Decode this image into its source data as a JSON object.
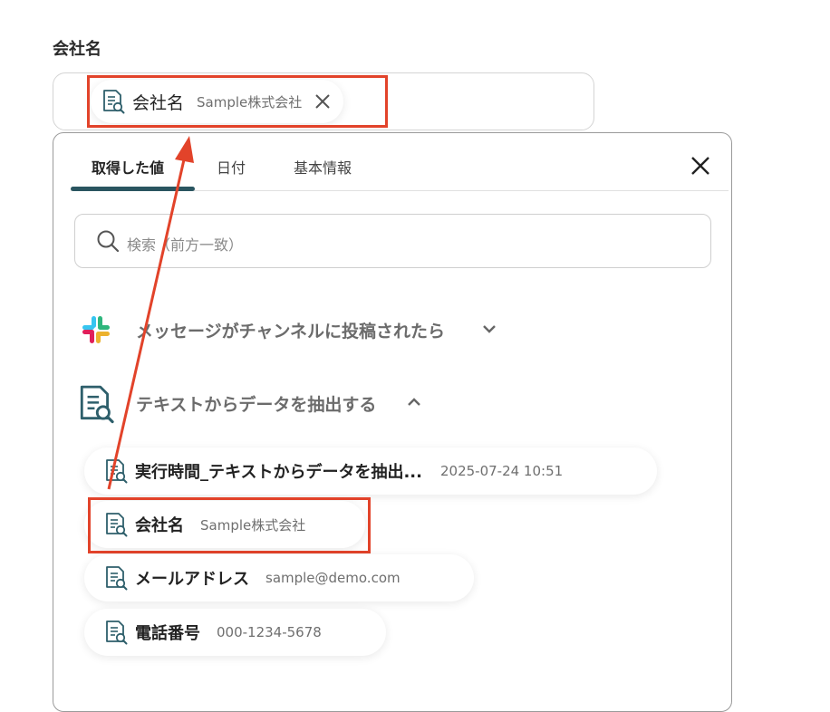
{
  "field": {
    "label": "会社名",
    "selected_chip": {
      "name": "会社名",
      "value": "Sample株式会社"
    }
  },
  "panel": {
    "tabs": [
      {
        "label": "取得した値",
        "active": true
      },
      {
        "label": "日付",
        "active": false
      },
      {
        "label": "基本情報",
        "active": false
      }
    ],
    "search_placeholder": "検索（前方一致）",
    "sections": [
      {
        "label": "メッセージがチャンネルに投稿されたら",
        "expanded": false,
        "icon": "slack-icon"
      },
      {
        "label": "テキストからデータを抽出する",
        "expanded": true,
        "icon": "document-search-icon"
      }
    ],
    "items": [
      {
        "name": "実行時間_テキストからデータを抽出...",
        "value": "2025-07-24 10:51"
      },
      {
        "name": "会社名",
        "value": "Sample株式会社"
      },
      {
        "name": "メールアドレス",
        "value": "sample@demo.com"
      },
      {
        "name": "電話番号",
        "value": "000-1234-5678"
      }
    ]
  },
  "colors": {
    "annotation_red": "#e2432a",
    "tab_accent": "#2a5560",
    "icon_teal": "#2e5f6b"
  }
}
